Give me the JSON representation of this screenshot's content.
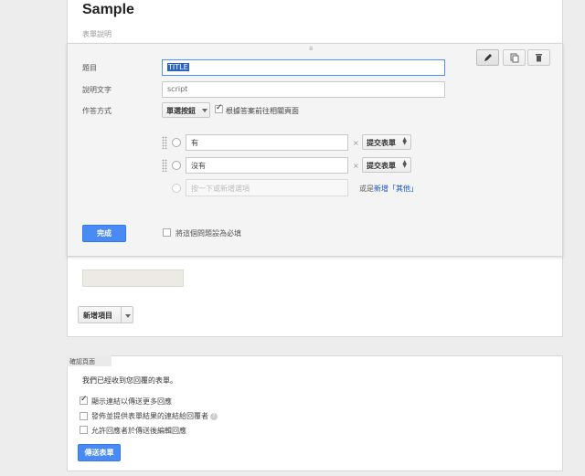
{
  "form": {
    "title": "Sample",
    "description": "表單說明"
  },
  "question": {
    "title_label": "題目",
    "title_value": "TITLE",
    "help_label": "說明文字",
    "help_value": "script",
    "type_label": "作答方式",
    "type_value": "單選按鈕",
    "go_to_page_label": "根據答案前往相關頁面",
    "go_to_page_checked": true,
    "options": [
      {
        "value": "有",
        "navigation": "提交表單"
      },
      {
        "value": "沒有",
        "navigation": "提交表單"
      }
    ],
    "add_option_placeholder": "按一下或新增選項",
    "add_other_prefix": "或是",
    "add_other_link": "新增「其他」",
    "done_label": "完成",
    "required_label": "將這個問題設為必填",
    "required_checked": false
  },
  "add_item": {
    "label": "新增項目"
  },
  "confirmation": {
    "tag": "確認頁面",
    "message": "我們已經收到您回覆的表單。",
    "options": [
      {
        "label": "顯示連結以傳送更多回應",
        "checked": true
      },
      {
        "label": "發佈並提供表單結果的連結給回覆者",
        "checked": false
      },
      {
        "label": "允許回應者於傳送後編輯回應",
        "checked": false
      }
    ],
    "submit_label": "傳送表單"
  },
  "icons": [
    "pencil-icon",
    "duplicate-icon",
    "trash-icon",
    "help-icon"
  ],
  "colors": {
    "primary_button": "#4a8af4",
    "focus_border": "#4d90fe",
    "link": "#1155cc"
  }
}
